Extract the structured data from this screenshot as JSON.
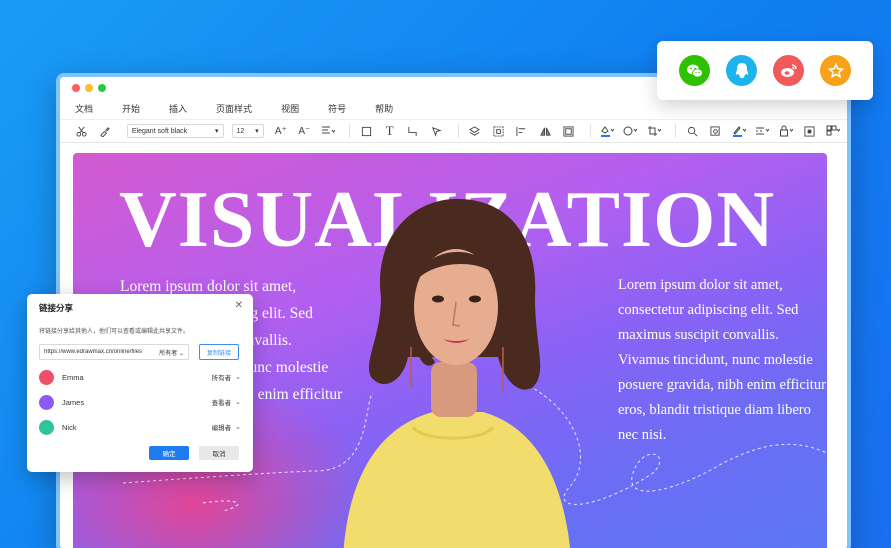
{
  "menu": [
    "文档",
    "开始",
    "插入",
    "页面样式",
    "视图",
    "符号",
    "帮助"
  ],
  "toolbar": {
    "font_family": "Elegant soft black",
    "font_size": "12",
    "grow_font_glyph": "A⁺",
    "shrink_font_glyph": "A⁻",
    "text_glyph": "T"
  },
  "canvas": {
    "headline": "VISUALIZATION",
    "body_left": "Lorem ipsum dolor sit amet, consectetur adipiscing elit. Sed maximus suscipit convallis. Vivamus tincidunt, nunc molestie posuere gravida, nibh enim efficitur eros, blandit tristique",
    "body_right": "Lorem ipsum dolor sit amet, consectetur adipiscing elit. Sed maximus suscipit convallis. Vivamus tincidunt, nunc molestie posuere gravida, nibh enim efficitur eros, blandit tristique diam libero nec nisi."
  },
  "share_icons": [
    {
      "icon": "wechat-icon",
      "color": "#2dc100"
    },
    {
      "icon": "qq-icon",
      "color": "#1fb3ee"
    },
    {
      "icon": "weibo-icon",
      "color": "#f25a5a"
    },
    {
      "icon": "favorite-star-icon",
      "color": "#f7a21b"
    }
  ],
  "dialog": {
    "title": "链接分享",
    "description": "将链接分享给其他人，他们可以查看或编辑此共享文件。",
    "link": "https://www.edrawmax.cn/online/files",
    "link_permission": "所有者",
    "copy_label": "复制链接",
    "users": [
      {
        "name": "Emma",
        "role": "所有者",
        "avatar_color": "#ef4f6a"
      },
      {
        "name": "James",
        "role": "查看者",
        "avatar_color": "#8a5cf5"
      },
      {
        "name": "Nick",
        "role": "编辑者",
        "avatar_color": "#2fc59a"
      }
    ],
    "ok_label": "确定",
    "cancel_label": "取消"
  },
  "colors": {
    "accent": "#1e7cf0",
    "background": "#1a8cf3"
  }
}
